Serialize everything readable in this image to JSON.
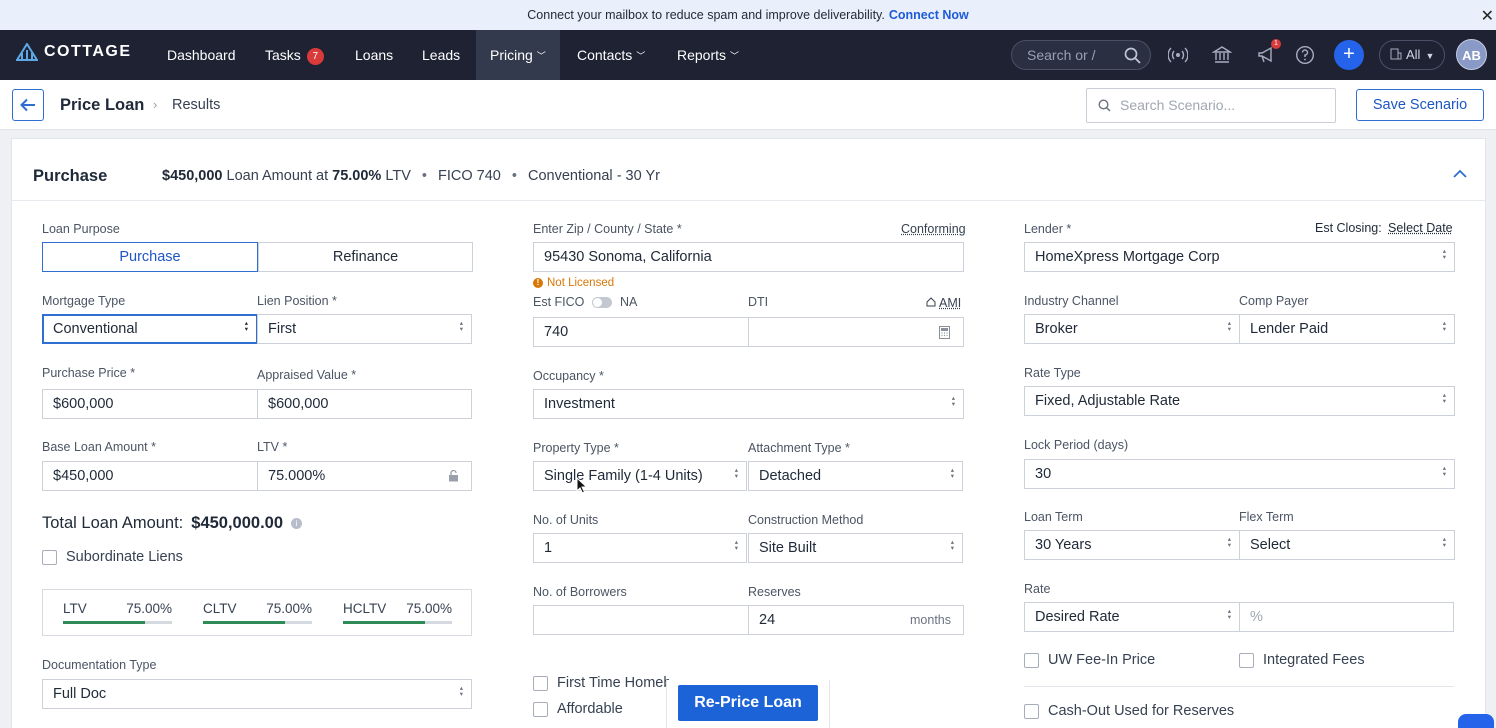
{
  "banner": {
    "text": "Connect your mailbox to reduce spam and improve deliverability.",
    "link": "Connect Now",
    "close": "✕"
  },
  "nav": {
    "logo": "COTTAGE",
    "items": [
      {
        "label": "Dashboard"
      },
      {
        "label": "Tasks",
        "badge": "7"
      },
      {
        "label": "Loans"
      },
      {
        "label": "Leads"
      },
      {
        "label": "Pricing",
        "active": true
      },
      {
        "label": "Contacts"
      },
      {
        "label": "Reports"
      }
    ],
    "search_placeholder": "Search or /",
    "notification_count": "1",
    "workspace": "All",
    "avatar": "AB"
  },
  "header": {
    "title": "Price Loan",
    "crumb": "Results",
    "search_placeholder": "Search Scenario...",
    "save_label": "Save Scenario"
  },
  "card": {
    "title": "Purchase",
    "summary": {
      "amount": "$450,000",
      "amount_label": "Loan Amount at",
      "ltv": "75.00%",
      "ltv_label": "LTV",
      "fico": "FICO 740",
      "product": "Conventional",
      "term": "- 30 Yr"
    }
  },
  "left": {
    "loan_purpose_label": "Loan Purpose",
    "purpose_options": [
      "Purchase",
      "Refinance"
    ],
    "mortgage_type_label": "Mortgage Type",
    "mortgage_type": "Conventional",
    "lien_label": "Lien Position *",
    "lien": "First",
    "purchase_price_label": "Purchase Price *",
    "purchase_price": "$600,000",
    "appraised_label": "Appraised Value *",
    "appraised": "$600,000",
    "base_loan_label": "Base Loan Amount *",
    "base_loan": "$450,000",
    "ltv_label": "LTV *",
    "ltv": "75.000%",
    "total_label": "Total Loan Amount:",
    "total_value": "$450,000.00",
    "subordinate_label": "Subordinate Liens",
    "ratios": [
      {
        "label": "LTV",
        "value": "75.00%",
        "fill": 0.75
      },
      {
        "label": "CLTV",
        "value": "75.00%",
        "fill": 0.75
      },
      {
        "label": "HCLTV",
        "value": "75.00%",
        "fill": 0.75
      }
    ],
    "doc_type_label": "Documentation Type",
    "doc_type": "Full Doc"
  },
  "middle": {
    "zip_label": "Enter Zip / County / State *",
    "conforming": "Conforming",
    "zip": "95430 Sonoma, California",
    "not_licensed": "Not Licensed",
    "fico_label": "Est FICO",
    "na_label": "NA",
    "fico": "740",
    "dti_label": "DTI",
    "ami": "AMI",
    "dti": "",
    "occupancy_label": "Occupancy *",
    "occupancy": "Investment",
    "property_type_label": "Property Type *",
    "property_type": "Single Family (1-4 Units)",
    "attachment_label": "Attachment Type *",
    "attachment": "Detached",
    "units_label": "No. of Units",
    "units": "1",
    "construction_label": "Construction Method",
    "construction": "Site Built",
    "borrowers_label": "No. of Borrowers",
    "borrowers": "",
    "reserves_label": "Reserves",
    "reserves": "24",
    "reserves_unit": "months",
    "first_time": "First Time Homebuyer",
    "affordable": "Affordable",
    "reprice": "Re-Price Loan"
  },
  "right": {
    "lender_label": "Lender *",
    "est_closing_label": "Est Closing:",
    "select_date": "Select Date",
    "lender": "HomeXpress Mortgage Corp",
    "channel_label": "Industry Channel",
    "channel": "Broker",
    "comp_label": "Comp Payer",
    "comp": "Lender Paid",
    "rate_type_label": "Rate Type",
    "rate_type": "Fixed, Adjustable Rate",
    "lock_label": "Lock Period (days)",
    "lock": "30",
    "term_label": "Loan Term",
    "term": "30 Years",
    "flex_label": "Flex Term",
    "flex": "Select",
    "rate_label": "Rate",
    "rate_mode": "Desired Rate",
    "rate_placeholder": "%",
    "uw_fee": "UW Fee-In Price",
    "integrated": "Integrated Fees",
    "cashout": "Cash-Out Used for Reserves"
  }
}
